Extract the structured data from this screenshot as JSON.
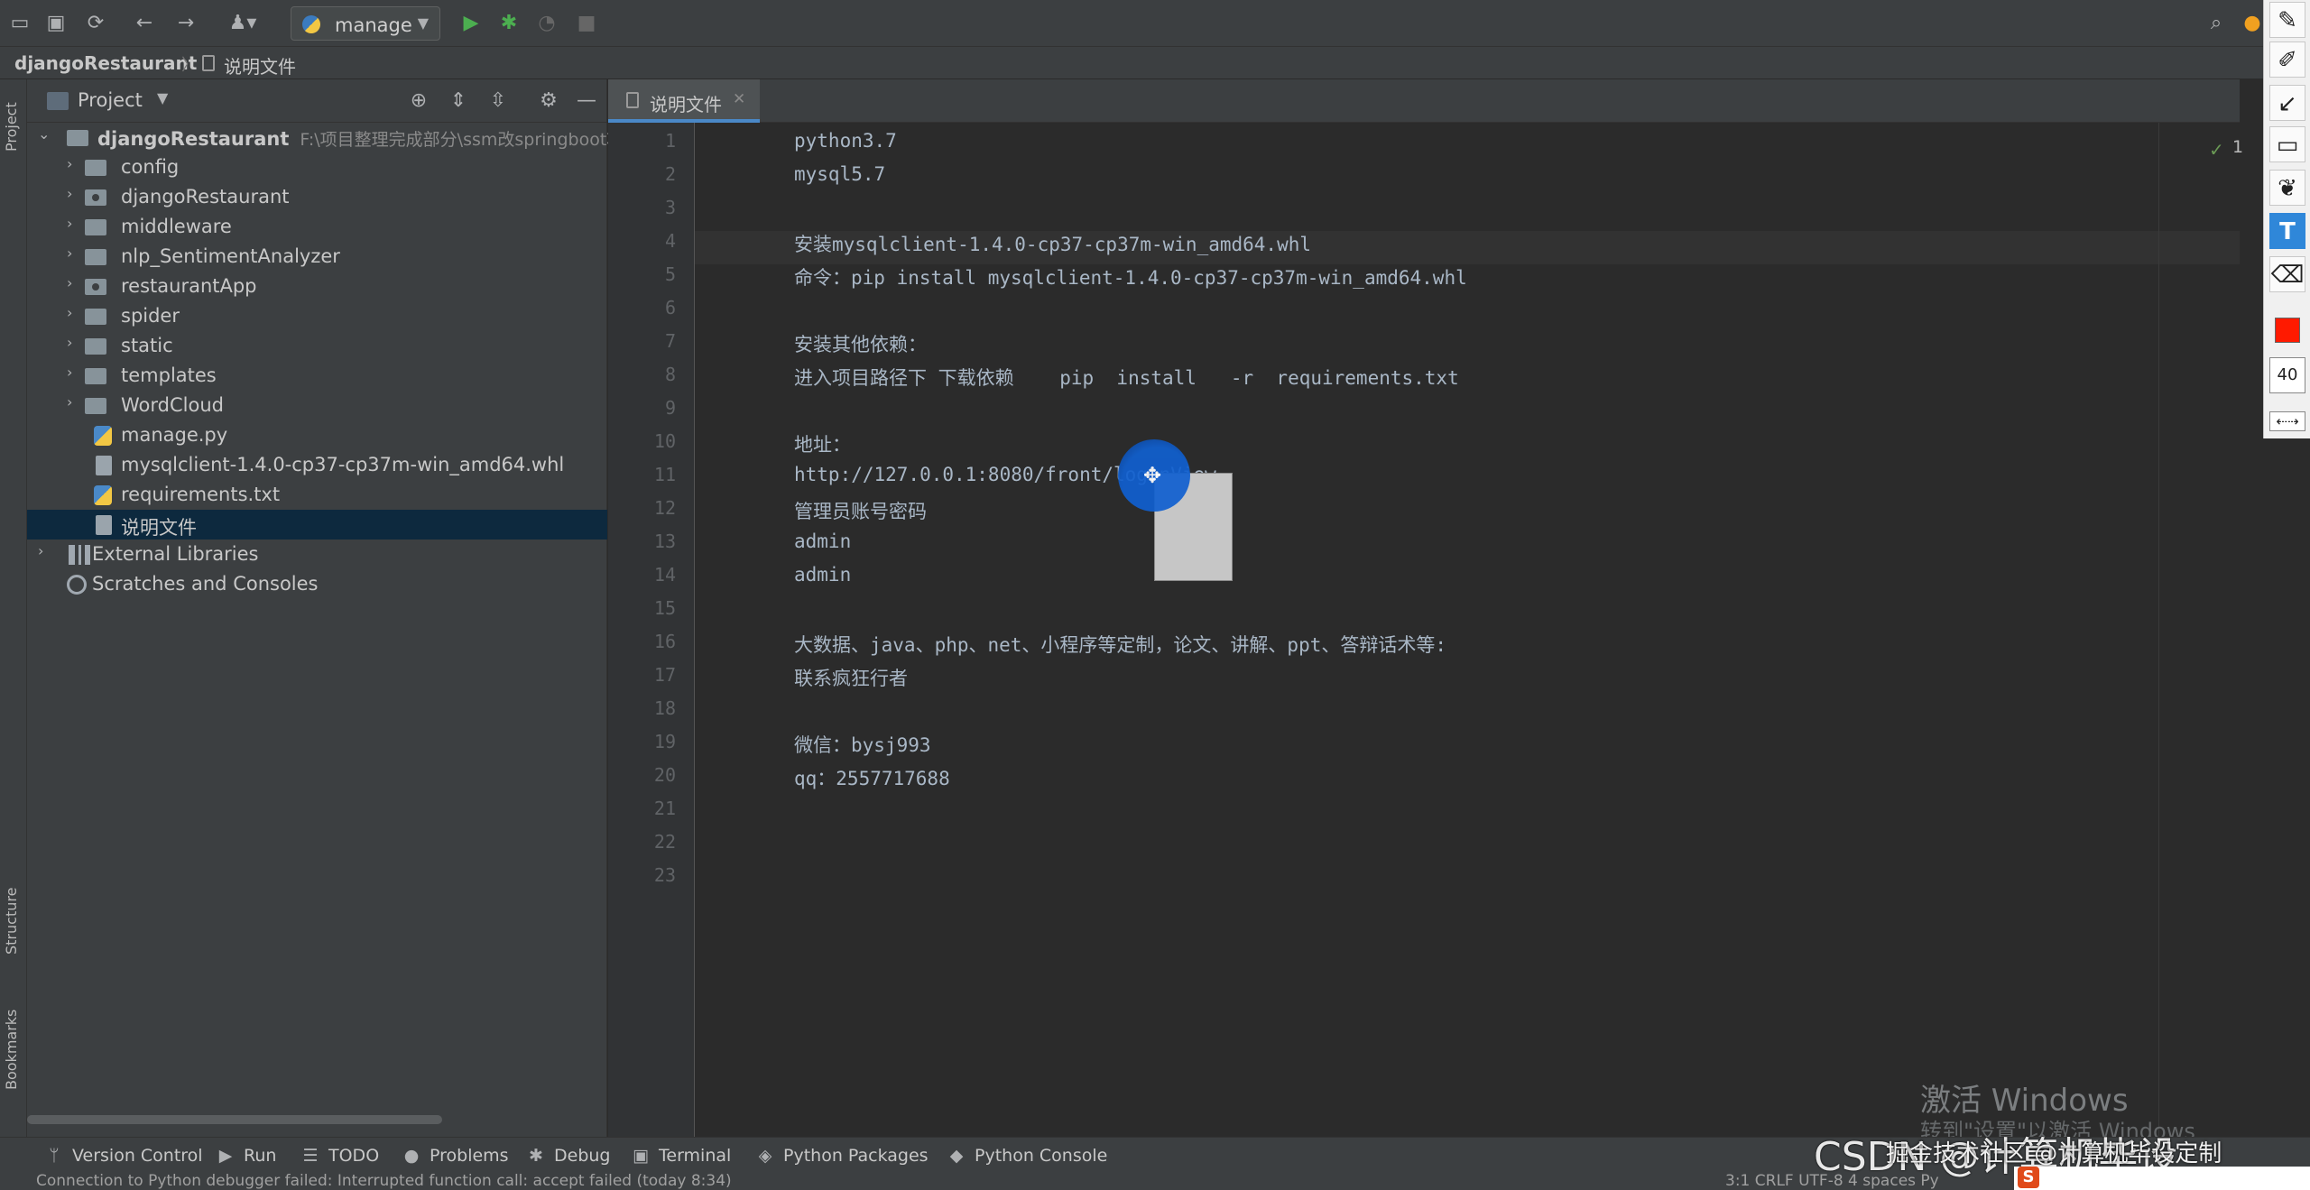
{
  "toolbar": {
    "run_config": "manage",
    "icons": [
      "open-folder-icon",
      "save-icon",
      "sync-icon",
      "back-icon",
      "forward-icon",
      "user-icon",
      "run-icon",
      "debug-icon",
      "coverage-icon",
      "stop-icon",
      "search-icon",
      "update-icon"
    ]
  },
  "breadcrumb": {
    "project": "djangoRestaurant",
    "file": "说明文件"
  },
  "left_strip": {
    "project": "Project",
    "structure": "Structure",
    "bookmarks": "Bookmarks"
  },
  "project_panel": {
    "title": "Project",
    "tree": [
      {
        "label": "djangoRestaurant",
        "path": "F:\\项目整理完成部分\\ssm改springboot项"
      },
      {
        "label": "config"
      },
      {
        "label": "djangoRestaurant"
      },
      {
        "label": "middleware"
      },
      {
        "label": "nlp_SentimentAnalyzer"
      },
      {
        "label": "restaurantApp"
      },
      {
        "label": "spider"
      },
      {
        "label": "static"
      },
      {
        "label": "templates"
      },
      {
        "label": "WordCloud"
      },
      {
        "label": "manage.py"
      },
      {
        "label": "mysqlclient-1.4.0-cp37-cp37m-win_amd64.whl"
      },
      {
        "label": "requirements.txt"
      },
      {
        "label": "说明文件"
      },
      {
        "label": "External Libraries"
      },
      {
        "label": "Scratches and Consoles"
      }
    ]
  },
  "editor": {
    "tab": "说明文件",
    "inspection_count": "1",
    "line_numbers": [
      "1",
      "2",
      "3",
      "4",
      "5",
      "6",
      "7",
      "8",
      "9",
      "10",
      "11",
      "12",
      "13",
      "14",
      "15",
      "16",
      "17",
      "18",
      "19",
      "20",
      "21",
      "22",
      "23"
    ],
    "lines": [
      "python3.7",
      "mysql5.7",
      "",
      "安装mysqlclient-1.4.0-cp37-cp37m-win_amd64.whl",
      "命令：pip install mysqlclient-1.4.0-cp37-cp37m-win_amd64.whl",
      "",
      "安装其他依赖：",
      "进入项目路径下 下载依赖    pip  install   -r  requirements.txt",
      "",
      "地址：",
      "http://127.0.0.1:8080/front/loginView",
      "管理员账号密码",
      "admin",
      "admin",
      "",
      "大数据、java、php、net、小程序等定制，论文、讲解、ppt、答辩话术等:",
      "联系疯狂行者",
      "",
      "微信：bysj993",
      "qq：2557717688",
      "",
      "",
      ""
    ]
  },
  "draw_toolbar": {
    "size": "40",
    "color": "#ff1a00"
  },
  "overlay": {
    "activate_title": "激活 Windows",
    "activate_sub": "转到\"设置\"以激活 Windows",
    "watermark": "CSDN @计算机毕设",
    "watermark_sub": "掘金技术社区 @计算机毕设定制"
  },
  "tool_windows": [
    "Version Control",
    "Run",
    "TODO",
    "Problems",
    "Debug",
    "Terminal",
    "Python Packages",
    "Python Console"
  ],
  "status": {
    "message": "Connection to Python debugger failed: Interrupted function call: accept failed (today 8:34)",
    "position": "3:1   CRLF   UTF-8   4 spaces   Py"
  }
}
